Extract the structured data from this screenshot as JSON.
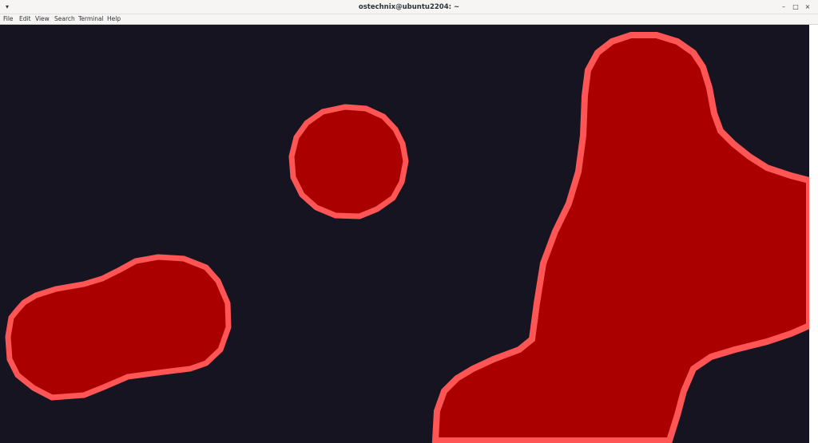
{
  "window": {
    "title": "ostechnix@ubuntu2204: ~",
    "controls": {
      "app_menu_icon": "app-menu-icon",
      "minimize_icon": "minimize-icon",
      "maximize_icon": "maximize-icon",
      "close_icon": "close-icon"
    }
  },
  "menubar": {
    "items": [
      "File",
      "Edit",
      "View",
      "Search",
      "Terminal",
      "Help"
    ]
  },
  "terminal": {
    "background_color": "#171421",
    "blob_fill_color": "#aa0000",
    "blob_outline_color": "#ff5555"
  }
}
